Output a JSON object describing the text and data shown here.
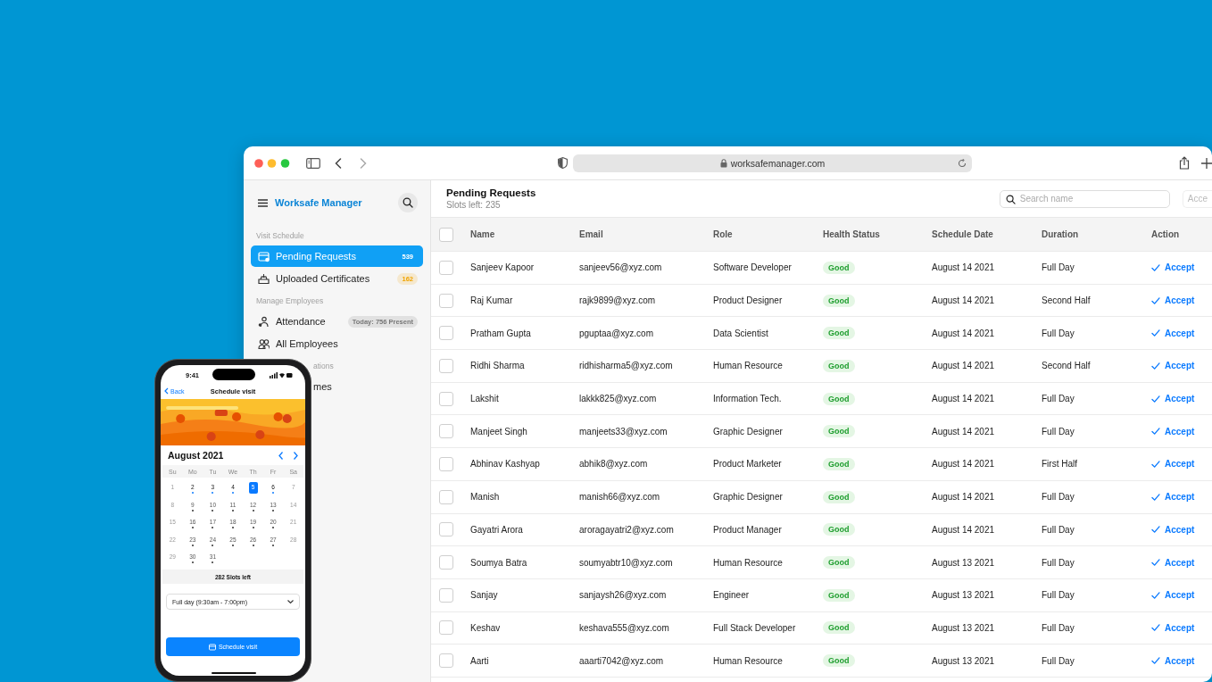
{
  "browser": {
    "url": "worksafemanager.com"
  },
  "sidebar": {
    "title": "Worksafe Manager",
    "items": [
      {
        "kind": "section",
        "label": "Visit Schedule"
      },
      {
        "kind": "item",
        "label": "Pending Requests",
        "badge": "539",
        "color": "#ffffff",
        "selected": true
      },
      {
        "kind": "item",
        "label": "Uploaded Certificates",
        "badge": "162",
        "color": "#f0a400",
        "selected": false
      },
      {
        "kind": "section",
        "label": "Manage Employees"
      },
      {
        "kind": "item",
        "label": "Attendance",
        "badge": "Today: 756 Present",
        "color": "#777777",
        "selected": false
      },
      {
        "kind": "item",
        "label": "All Employees",
        "selected": false
      },
      {
        "kind": "section",
        "label": "ations",
        "covered": true
      },
      {
        "kind": "item",
        "label": "mes",
        "covered": true,
        "selected": false
      }
    ]
  },
  "main": {
    "title": "Pending Requests",
    "subtitle": "Slots left: 235",
    "search": {
      "placeholder": "Search name"
    },
    "button": "Acce"
  },
  "table": {
    "all_selected": false,
    "columns": [
      "Name",
      "Email",
      "Role",
      "Health Status",
      "Schedule Date",
      "Duration",
      "Action"
    ],
    "rows": [
      {
        "selected": false,
        "name": "Sanjeev Kapoor",
        "email": "sanjeev56@xyz.com",
        "role": "Software Developer",
        "health": "Good",
        "date": "August 14 2021",
        "duration": "Full Day",
        "action": "Accept"
      },
      {
        "selected": false,
        "name": "Raj Kumar",
        "email": "rajk9899@xyz.com",
        "role": "Product Designer",
        "health": "Good",
        "date": "August 14 2021",
        "duration": "Second Half",
        "action": "Accept"
      },
      {
        "selected": false,
        "name": "Pratham Gupta",
        "email": "pguptaa@xyz.com",
        "role": "Data Scientist",
        "health": "Good",
        "date": "August 14 2021",
        "duration": "Full Day",
        "action": "Accept"
      },
      {
        "selected": false,
        "name": "Ridhi Sharma",
        "email": "ridhisharma5@xyz.com",
        "role": "Human Resource",
        "health": "Good",
        "date": "August 14 2021",
        "duration": "Second Half",
        "action": "Accept"
      },
      {
        "selected": false,
        "name": "Lakshit",
        "email": "lakkk825@xyz.com",
        "role": "Information Tech.",
        "health": "Good",
        "date": "August 14 2021",
        "duration": "Full Day",
        "action": "Accept"
      },
      {
        "selected": false,
        "name": "Manjeet Singh",
        "email": "manjeets33@xyz.com",
        "role": "Graphic Designer",
        "health": "Good",
        "date": "August 14 2021",
        "duration": "Full Day",
        "action": "Accept"
      },
      {
        "selected": false,
        "name": "Abhinav Kashyap",
        "email": "abhik8@xyz.com",
        "role": "Product Marketer",
        "health": "Good",
        "date": "August 14 2021",
        "duration": "First Half",
        "action": "Accept"
      },
      {
        "selected": false,
        "name": "Manish",
        "email": "manish66@xyz.com",
        "role": "Graphic Designer",
        "health": "Good",
        "date": "August 14 2021",
        "duration": "Full Day",
        "action": "Accept"
      },
      {
        "selected": false,
        "name": "Gayatri Arora",
        "email": "aroragayatri2@xyz.com",
        "role": "Product Manager",
        "health": "Good",
        "date": "August 14 2021",
        "duration": "Full Day",
        "action": "Accept"
      },
      {
        "selected": false,
        "name": "Soumya Batra",
        "email": "soumyabtr10@xyz.com",
        "role": "Human Resource",
        "health": "Good",
        "date": "August 13 2021",
        "duration": "Full Day",
        "action": "Accept"
      },
      {
        "selected": false,
        "name": "Sanjay",
        "email": "sanjaysh26@xyz.com",
        "role": "Engineer",
        "health": "Good",
        "date": "August 13 2021",
        "duration": "Full Day",
        "action": "Accept"
      },
      {
        "selected": false,
        "name": "Keshav",
        "email": "keshava555@xyz.com",
        "role": "Full Stack Developer",
        "health": "Good",
        "date": "August 13 2021",
        "duration": "Full Day",
        "action": "Accept"
      },
      {
        "selected": false,
        "name": "Aarti",
        "email": "aaarti7042@xyz.com",
        "role": "Human Resource",
        "health": "Good",
        "date": "August 13 2021",
        "duration": "Full Day",
        "action": "Accept"
      }
    ]
  },
  "phone": {
    "time": "9:41",
    "back": "Back",
    "title": "Schedule visit",
    "month": "August 2021",
    "weekdays": [
      "Su",
      "Mo",
      "Tu",
      "We",
      "Th",
      "Fr",
      "Sa"
    ],
    "days": [
      {
        "label": "1",
        "disabled": true,
        "available": false,
        "selected": false
      },
      {
        "label": "2",
        "disabled": false,
        "available": true,
        "selected": false
      },
      {
        "label": "3",
        "disabled": false,
        "available": true,
        "selected": false
      },
      {
        "label": "4",
        "disabled": false,
        "available": true,
        "selected": false
      },
      {
        "label": "5",
        "disabled": false,
        "available": true,
        "selected": true
      },
      {
        "label": "6",
        "disabled": false,
        "available": true,
        "selected": false
      },
      {
        "label": "7",
        "disabled": true,
        "available": false,
        "selected": false
      },
      {
        "label": "8",
        "disabled": true,
        "available": false,
        "selected": false
      },
      {
        "label": "9",
        "disabled": false,
        "available": false,
        "selected": false
      },
      {
        "label": "10",
        "disabled": false,
        "available": false,
        "selected": false
      },
      {
        "label": "11",
        "disabled": false,
        "available": false,
        "selected": false
      },
      {
        "label": "12",
        "disabled": false,
        "available": false,
        "selected": false
      },
      {
        "label": "13",
        "disabled": false,
        "available": false,
        "selected": false
      },
      {
        "label": "14",
        "disabled": true,
        "available": false,
        "selected": false
      },
      {
        "label": "15",
        "disabled": true,
        "available": false,
        "selected": false
      },
      {
        "label": "16",
        "disabled": false,
        "available": false,
        "selected": false
      },
      {
        "label": "17",
        "disabled": false,
        "available": false,
        "selected": false
      },
      {
        "label": "18",
        "disabled": false,
        "available": false,
        "selected": false
      },
      {
        "label": "19",
        "disabled": false,
        "available": false,
        "selected": false
      },
      {
        "label": "20",
        "disabled": false,
        "available": false,
        "selected": false
      },
      {
        "label": "21",
        "disabled": true,
        "available": false,
        "selected": false
      },
      {
        "label": "22",
        "disabled": true,
        "available": false,
        "selected": false
      },
      {
        "label": "23",
        "disabled": false,
        "available": false,
        "selected": false
      },
      {
        "label": "24",
        "disabled": false,
        "available": false,
        "selected": false
      },
      {
        "label": "25",
        "disabled": false,
        "available": false,
        "selected": false
      },
      {
        "label": "26",
        "disabled": false,
        "available": false,
        "selected": false
      },
      {
        "label": "27",
        "disabled": false,
        "available": false,
        "selected": false
      },
      {
        "label": "28",
        "disabled": true,
        "available": false,
        "selected": false
      },
      {
        "label": "29",
        "disabled": true,
        "available": false,
        "selected": false
      },
      {
        "label": "30",
        "disabled": false,
        "available": false,
        "selected": false
      },
      {
        "label": "31",
        "disabled": false,
        "available": false,
        "selected": false
      }
    ],
    "slots": "282 Slots left",
    "select": "Full day (9:30am - 7:00pm)",
    "button": "Schedule visit"
  }
}
